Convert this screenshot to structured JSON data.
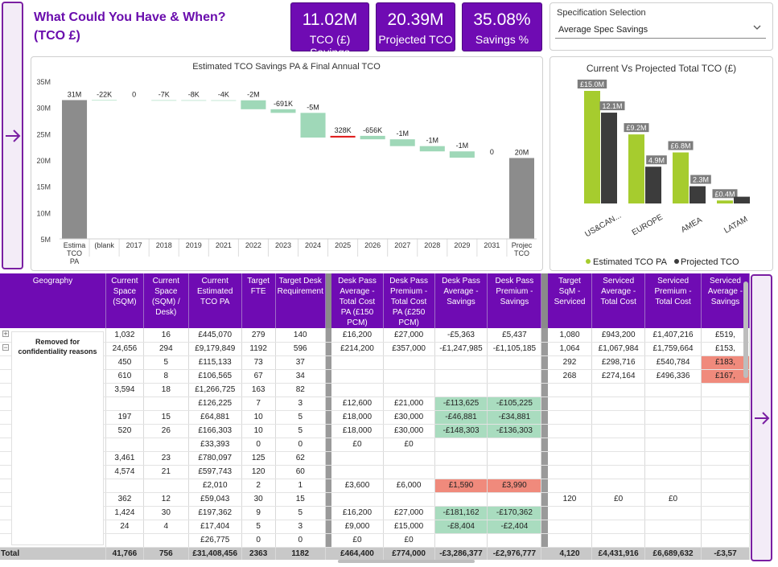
{
  "header": {
    "title_line1": "What Could You  Have & When?",
    "title_line2": "(TCO £)"
  },
  "kpis": [
    {
      "value": "11.02M",
      "label": "TCO (£) Savings"
    },
    {
      "value": "20.39M",
      "label": "Projected TCO"
    },
    {
      "value": "35.08%",
      "label": "Savings %"
    }
  ],
  "slicer": {
    "title": "Specification Selection",
    "selected": "Average Spec Savings"
  },
  "waterfall": {
    "title": "Estimated TCO Savings PA & Final Annual TCO",
    "y_ticks": [
      "35M",
      "30M",
      "25M",
      "20M",
      "15M",
      "10M",
      "5M"
    ],
    "categories": [
      "Estima TCO PA",
      "(blank",
      "2017",
      "2018",
      "2019",
      "2021",
      "2022",
      "2023",
      "2024",
      "2025",
      "2026",
      "2027",
      "2028",
      "2029",
      "2031",
      "Projec TCO"
    ],
    "labels": [
      "31M",
      "-22K",
      "0",
      "-7K",
      "-8K",
      "-4K",
      "-2M",
      "-691K",
      "-5M",
      "328K",
      "-656K",
      "-1M",
      "-1M",
      "-1M",
      "0",
      "20M"
    ]
  },
  "chart_data": [
    {
      "type": "bar",
      "title": "Estimated TCO Savings PA & Final Annual TCO",
      "subtype": "waterfall",
      "categories": [
        "Estima TCO PA",
        "(blank",
        "2017",
        "2018",
        "2019",
        "2021",
        "2022",
        "2023",
        "2024",
        "2025",
        "2026",
        "2027",
        "2028",
        "2029",
        "2031",
        "Projec TCO"
      ],
      "values": [
        31.41,
        -0.022,
        0,
        -0.007,
        -0.008,
        -0.004,
        -1.7,
        -0.691,
        -4.7,
        0.328,
        -0.656,
        -1.3,
        -1.0,
        -1.2,
        0,
        20.39
      ],
      "ylim": [
        5,
        35
      ],
      "colors": {
        "total": "#8c8c8c",
        "decrease": "#9fd8b8",
        "increase": "#e02020"
      }
    },
    {
      "type": "bar",
      "title": "Current Vs Projected Total TCO (£)",
      "categories": [
        "US&CAN...",
        "EUROPE",
        "AMEA",
        "LATAM"
      ],
      "series": [
        {
          "name": "Estimated TCO PA",
          "values": [
            15.0,
            9.2,
            6.8,
            0.4
          ],
          "labels": [
            "£15.0M",
            "£9.2M",
            "£6.8M",
            "£0.4M"
          ],
          "color": "#a6cc2e"
        },
        {
          "name": "Projected TCO",
          "values": [
            12.1,
            4.9,
            2.3,
            0.9
          ],
          "labels": [
            "12.1M",
            "4.9M",
            "2.3M",
            ""
          ],
          "color": "#3c3c3c"
        }
      ],
      "legend": "bottom"
    }
  ],
  "bar_chart": {
    "title": "Current Vs Projected Total TCO (£)",
    "legend": [
      "Estimated TCO PA",
      "Projected TCO"
    ]
  },
  "table": {
    "redaction_note": "Removed for confidentiality reasons",
    "headers": [
      "Geography",
      "Current Space (SQM)",
      "Current Space (SQM) / Desk)",
      "Current Estimated TCO PA",
      "Target FTE",
      "Target Desk Requirement",
      "Desk Pass Average - Total Cost PA (£150 PCM)",
      "Desk Pass Premium - Total Cost PA (£250 PCM)",
      "Desk Pass Average - Savings",
      "Desk Pass Premium - Savings",
      "Target SqM - Serviced",
      "Serviced Average - Total Cost",
      "Serviced Premium - Total Cost",
      "Serviced Average - Savings"
    ],
    "rows": [
      [
        "",
        "1,032",
        "16",
        "£445,070",
        "279",
        "140",
        "£16,200",
        "£27,000",
        "-£5,363",
        "£5,437",
        "1,080",
        "£943,200",
        "£1,407,216",
        "£519,"
      ],
      [
        "",
        "24,656",
        "294",
        "£9,179,849",
        "1192",
        "596",
        "£214,200",
        "£357,000",
        "-£1,247,985",
        "-£1,105,185",
        "1,064",
        "£1,067,984",
        "£1,759,664",
        "£153,"
      ],
      [
        "",
        "450",
        "5",
        "£115,133",
        "73",
        "37",
        "",
        "",
        "",
        "",
        "292",
        "£298,716",
        "£540,784",
        "£183,"
      ],
      [
        "",
        "610",
        "8",
        "£106,565",
        "67",
        "34",
        "",
        "",
        "",
        "",
        "268",
        "£274,164",
        "£496,336",
        "£167,"
      ],
      [
        "",
        "3,594",
        "18",
        "£1,266,725",
        "163",
        "82",
        "",
        "",
        "",
        "",
        "",
        "",
        "",
        ""
      ],
      [
        "",
        "",
        "",
        "£126,225",
        "7",
        "3",
        "£12,600",
        "£21,000",
        "-£113,625",
        "-£105,225",
        "",
        "",
        "",
        ""
      ],
      [
        "",
        "197",
        "15",
        "£64,881",
        "10",
        "5",
        "£18,000",
        "£30,000",
        "-£46,881",
        "-£34,881",
        "",
        "",
        "",
        ""
      ],
      [
        "",
        "520",
        "26",
        "£166,303",
        "10",
        "5",
        "£18,000",
        "£30,000",
        "-£148,303",
        "-£136,303",
        "",
        "",
        "",
        ""
      ],
      [
        "",
        "",
        "",
        "£33,393",
        "0",
        "0",
        "£0",
        "£0",
        "",
        "",
        "",
        "",
        "",
        ""
      ],
      [
        "",
        "3,461",
        "23",
        "£780,097",
        "125",
        "62",
        "",
        "",
        "",
        "",
        "",
        "",
        "",
        ""
      ],
      [
        "",
        "4,574",
        "21",
        "£597,743",
        "120",
        "60",
        "",
        "",
        "",
        "",
        "",
        "",
        "",
        ""
      ],
      [
        "",
        "",
        "",
        "£2,010",
        "2",
        "1",
        "£3,600",
        "£6,000",
        "£1,590",
        "£3,990",
        "",
        "",
        "",
        ""
      ],
      [
        "",
        "362",
        "12",
        "£59,043",
        "30",
        "15",
        "",
        "",
        "",
        "",
        "120",
        "£0",
        "£0",
        ""
      ],
      [
        "",
        "1,424",
        "30",
        "£197,362",
        "9",
        "5",
        "£16,200",
        "£27,000",
        "-£181,162",
        "-£170,362",
        "",
        "",
        "",
        ""
      ],
      [
        "",
        "24",
        "4",
        "£17,404",
        "5",
        "3",
        "£9,000",
        "£15,000",
        "-£8,404",
        "-£2,404",
        "",
        "",
        "",
        ""
      ],
      [
        "",
        "",
        "",
        "£26,775",
        "0",
        "0",
        "£0",
        "£0",
        "",
        "",
        "",
        "",
        "",
        ""
      ]
    ],
    "cell_colors": {
      "green": "#a9dcbf",
      "red": "#f08a7c"
    },
    "total": [
      "Total",
      "41,766",
      "756",
      "£31,408,456",
      "2363",
      "1182",
      "£464,400",
      "£774,000",
      "-£3,286,377",
      "-£2,976,777",
      "4,120",
      "£4,431,916",
      "£6,689,632",
      "-£3,57"
    ]
  },
  "icons": {
    "left_nav": "arrow-right-icon",
    "right_nav": "arrow-right-icon",
    "slicer_chevron": "chevron-down-icon"
  }
}
